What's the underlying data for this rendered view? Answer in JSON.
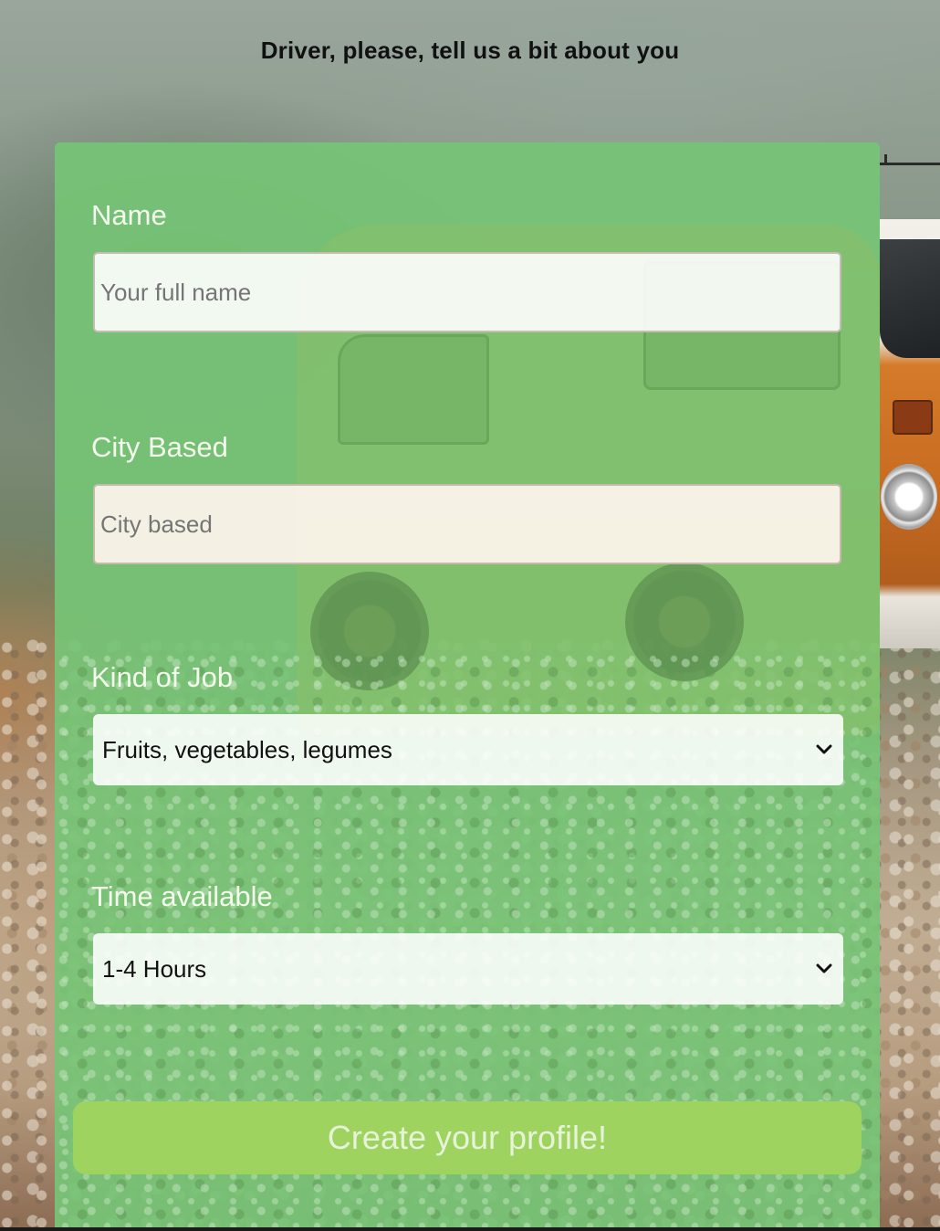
{
  "page": {
    "title": "Driver, please, tell us a bit about you"
  },
  "form": {
    "name": {
      "label": "Name",
      "placeholder": "Your full name",
      "value": ""
    },
    "city": {
      "label": "City Based",
      "placeholder": "City based",
      "value": ""
    },
    "job": {
      "label": "Kind of Job",
      "selected": "Fruits, vegetables, legumes"
    },
    "time": {
      "label": "Time available",
      "selected": "1-4 Hours"
    },
    "submit_label": "Create your profile!"
  },
  "icons": {
    "dropdown": "chevron-down-icon"
  },
  "colors": {
    "card": "#76c476",
    "button": "#9fd360",
    "label_text": "#f4faec"
  }
}
